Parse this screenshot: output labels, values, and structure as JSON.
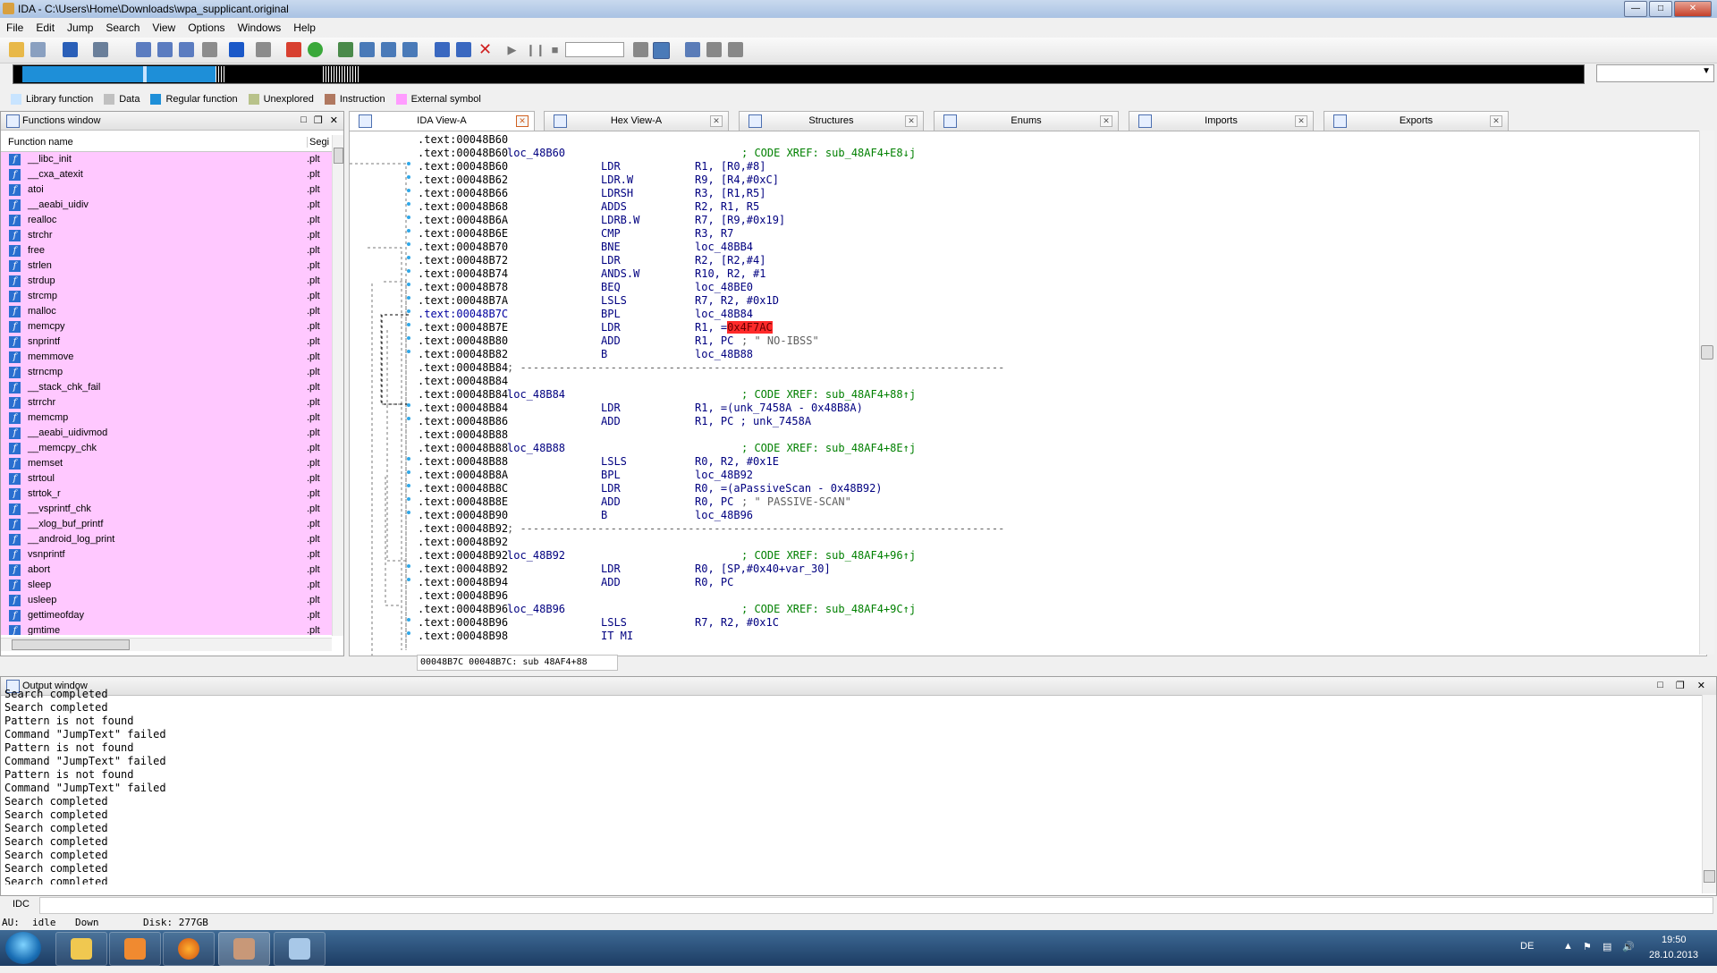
{
  "window": {
    "title": "IDA - C:\\Users\\Home\\Downloads\\wpa_supplicant.original"
  },
  "menu": [
    "File",
    "Edit",
    "Jump",
    "Search",
    "View",
    "Options",
    "Windows",
    "Help"
  ],
  "legend": [
    {
      "label": "Library function",
      "color": "#c8e4ff"
    },
    {
      "label": "Data",
      "color": "#c0c0c0"
    },
    {
      "label": "Regular function",
      "color": "#1e8fd8"
    },
    {
      "label": "Unexplored",
      "color": "#b8c28a"
    },
    {
      "label": "Instruction",
      "color": "#b07860"
    },
    {
      "label": "External symbol",
      "color": "#ff9cff"
    }
  ],
  "functions_window": {
    "title": "Functions window",
    "col_name": "Function name",
    "col_seg": "Segi",
    "items": [
      {
        "name": "__libc_init",
        "seg": ".plt"
      },
      {
        "name": "__cxa_atexit",
        "seg": ".plt"
      },
      {
        "name": "atoi",
        "seg": ".plt"
      },
      {
        "name": "__aeabi_uidiv",
        "seg": ".plt"
      },
      {
        "name": "realloc",
        "seg": ".plt"
      },
      {
        "name": "strchr",
        "seg": ".plt"
      },
      {
        "name": "free",
        "seg": ".plt"
      },
      {
        "name": "strlen",
        "seg": ".plt"
      },
      {
        "name": "strdup",
        "seg": ".plt"
      },
      {
        "name": "strcmp",
        "seg": ".plt"
      },
      {
        "name": "malloc",
        "seg": ".plt"
      },
      {
        "name": "memcpy",
        "seg": ".plt"
      },
      {
        "name": "snprintf",
        "seg": ".plt"
      },
      {
        "name": "memmove",
        "seg": ".plt"
      },
      {
        "name": "strncmp",
        "seg": ".plt"
      },
      {
        "name": "__stack_chk_fail",
        "seg": ".plt"
      },
      {
        "name": "strrchr",
        "seg": ".plt"
      },
      {
        "name": "memcmp",
        "seg": ".plt"
      },
      {
        "name": "__aeabi_uidivmod",
        "seg": ".plt"
      },
      {
        "name": "__memcpy_chk",
        "seg": ".plt"
      },
      {
        "name": "memset",
        "seg": ".plt"
      },
      {
        "name": "strtoul",
        "seg": ".plt"
      },
      {
        "name": "strtok_r",
        "seg": ".plt"
      },
      {
        "name": "__vsprintf_chk",
        "seg": ".plt"
      },
      {
        "name": "__xlog_buf_printf",
        "seg": ".plt"
      },
      {
        "name": "__android_log_print",
        "seg": ".plt"
      },
      {
        "name": "vsnprintf",
        "seg": ".plt"
      },
      {
        "name": "abort",
        "seg": ".plt"
      },
      {
        "name": "sleep",
        "seg": ".plt"
      },
      {
        "name": "usleep",
        "seg": ".plt"
      },
      {
        "name": "gettimeofday",
        "seg": ".plt"
      },
      {
        "name": "gmtime",
        "seg": ".plt"
      }
    ]
  },
  "tabs": [
    "IDA View-A",
    "Hex View-A",
    "Structures",
    "Enums",
    "Imports",
    "Exports"
  ],
  "disasm": [
    {
      "addr": ".text:00048B60",
      "label": "",
      "mn": "",
      "op": "",
      "cm": ""
    },
    {
      "addr": ".text:00048B60",
      "label": "loc_48B60",
      "mn": "",
      "op": "",
      "cm": "; CODE XREF: sub_48AF4+E8↓j"
    },
    {
      "addr": ".text:00048B60",
      "label": "",
      "mn": "LDR",
      "op": "R1, [R0,#8]",
      "cm": ""
    },
    {
      "addr": ".text:00048B62",
      "label": "",
      "mn": "LDR.W",
      "op": "R9, [R4,#0xC]",
      "cm": ""
    },
    {
      "addr": ".text:00048B66",
      "label": "",
      "mn": "LDRSH",
      "op": "R3, [R1,R5]",
      "cm": ""
    },
    {
      "addr": ".text:00048B68",
      "label": "",
      "mn": "ADDS",
      "op": "R2, R1, R5",
      "cm": ""
    },
    {
      "addr": ".text:00048B6A",
      "label": "",
      "mn": "LDRB.W",
      "op": "R7, [R9,#0x19]",
      "cm": ""
    },
    {
      "addr": ".text:00048B6E",
      "label": "",
      "mn": "CMP",
      "op": "R3, R7",
      "cm": ""
    },
    {
      "addr": ".text:00048B70",
      "label": "",
      "mn": "BNE",
      "op": "loc_48BB4",
      "cm": ""
    },
    {
      "addr": ".text:00048B72",
      "label": "",
      "mn": "LDR",
      "op": "R2, [R2,#4]",
      "cm": ""
    },
    {
      "addr": ".text:00048B74",
      "label": "",
      "mn": "ANDS.W",
      "op": "R10, R2, #1",
      "cm": ""
    },
    {
      "addr": ".text:00048B78",
      "label": "",
      "mn": "BEQ",
      "op": "loc_48BE0",
      "cm": ""
    },
    {
      "addr": ".text:00048B7A",
      "label": "",
      "mn": "LSLS",
      "op": "R7, R2, #0x1D",
      "cm": ""
    },
    {
      "addr": ".text:00048B7C",
      "label": "",
      "mn": "BPL",
      "op": "loc_48B84",
      "cm": "",
      "sel": true
    },
    {
      "addr": ".text:00048B7E",
      "label": "",
      "mn": "LDR",
      "op": "R1, =",
      "hl": "0x4F7AC",
      "cm": ""
    },
    {
      "addr": ".text:00048B80",
      "label": "",
      "mn": "ADD",
      "op": "R1, PC",
      "cm": "",
      "gy": "; \" NO-IBSS\""
    },
    {
      "addr": ".text:00048B82",
      "label": "",
      "mn": "B",
      "op": "loc_48B88",
      "cm": ""
    },
    {
      "addr": ".text:00048B84",
      "label": "; ---------------------------------------------------------------------------",
      "mn": "",
      "op": "",
      "cm": ""
    },
    {
      "addr": ".text:00048B84",
      "label": "",
      "mn": "",
      "op": "",
      "cm": ""
    },
    {
      "addr": ".text:00048B84",
      "label": "loc_48B84",
      "mn": "",
      "op": "",
      "cm": "; CODE XREF: sub_48AF4+88↑j"
    },
    {
      "addr": ".text:00048B84",
      "label": "",
      "mn": "LDR",
      "op": "R1, =(unk_7458A - 0x48B8A)",
      "cm": ""
    },
    {
      "addr": ".text:00048B86",
      "label": "",
      "mn": "ADD",
      "op": "R1, PC ; unk_7458A",
      "cm": ""
    },
    {
      "addr": ".text:00048B88",
      "label": "",
      "mn": "",
      "op": "",
      "cm": ""
    },
    {
      "addr": ".text:00048B88",
      "label": "loc_48B88",
      "mn": "",
      "op": "",
      "cm": "; CODE XREF: sub_48AF4+8E↑j"
    },
    {
      "addr": ".text:00048B88",
      "label": "",
      "mn": "LSLS",
      "op": "R0, R2, #0x1E",
      "cm": ""
    },
    {
      "addr": ".text:00048B8A",
      "label": "",
      "mn": "BPL",
      "op": "loc_48B92",
      "cm": ""
    },
    {
      "addr": ".text:00048B8C",
      "label": "",
      "mn": "LDR",
      "op": "R0, =(aPassiveScan - 0x48B92)",
      "cm": ""
    },
    {
      "addr": ".text:00048B8E",
      "label": "",
      "mn": "ADD",
      "op": "R0, PC",
      "cm": "",
      "gy": "; \" PASSIVE-SCAN\""
    },
    {
      "addr": ".text:00048B90",
      "label": "",
      "mn": "B",
      "op": "loc_48B96",
      "cm": ""
    },
    {
      "addr": ".text:00048B92",
      "label": "; ---------------------------------------------------------------------------",
      "mn": "",
      "op": "",
      "cm": ""
    },
    {
      "addr": ".text:00048B92",
      "label": "",
      "mn": "",
      "op": "",
      "cm": ""
    },
    {
      "addr": ".text:00048B92",
      "label": "loc_48B92",
      "mn": "",
      "op": "",
      "cm": "; CODE XREF: sub_48AF4+96↑j"
    },
    {
      "addr": ".text:00048B92",
      "label": "",
      "mn": "LDR",
      "op": "R0, [SP,#0x40+var_30]",
      "cm": ""
    },
    {
      "addr": ".text:00048B94",
      "label": "",
      "mn": "ADD",
      "op": "R0, PC",
      "cm": ""
    },
    {
      "addr": ".text:00048B96",
      "label": "",
      "mn": "",
      "op": "",
      "cm": ""
    },
    {
      "addr": ".text:00048B96",
      "label": "loc_48B96",
      "mn": "",
      "op": "",
      "cm": "; CODE XREF: sub_48AF4+9C↑j"
    },
    {
      "addr": ".text:00048B96",
      "label": "",
      "mn": "LSLS",
      "op": "R7, R2, #0x1C",
      "cm": ""
    },
    {
      "addr": ".text:00048B98",
      "label": "",
      "mn": "IT MI",
      "op": "",
      "cm": ""
    }
  ],
  "disasm_status": "00048B7C 00048B7C: sub 48AF4+88",
  "output_window": {
    "title": "Output window",
    "lines": [
      "Search completed",
      "Search completed",
      "Pattern is not found",
      "Command \"JumpText\" failed",
      "Pattern is not found",
      "Command \"JumpText\" failed",
      "Pattern is not found",
      "Command \"JumpText\" failed",
      "Search completed",
      "Search completed",
      "Search completed",
      "Search completed",
      "Search completed",
      "Search completed",
      "Search completed"
    ]
  },
  "idc_label": "IDC",
  "status": {
    "au": "AU:",
    "state": "idle",
    "dir": "Down",
    "disk": "Disk: 277GB"
  },
  "tray": {
    "lang": "DE",
    "time": "19:50",
    "date": "28.10.2013"
  }
}
